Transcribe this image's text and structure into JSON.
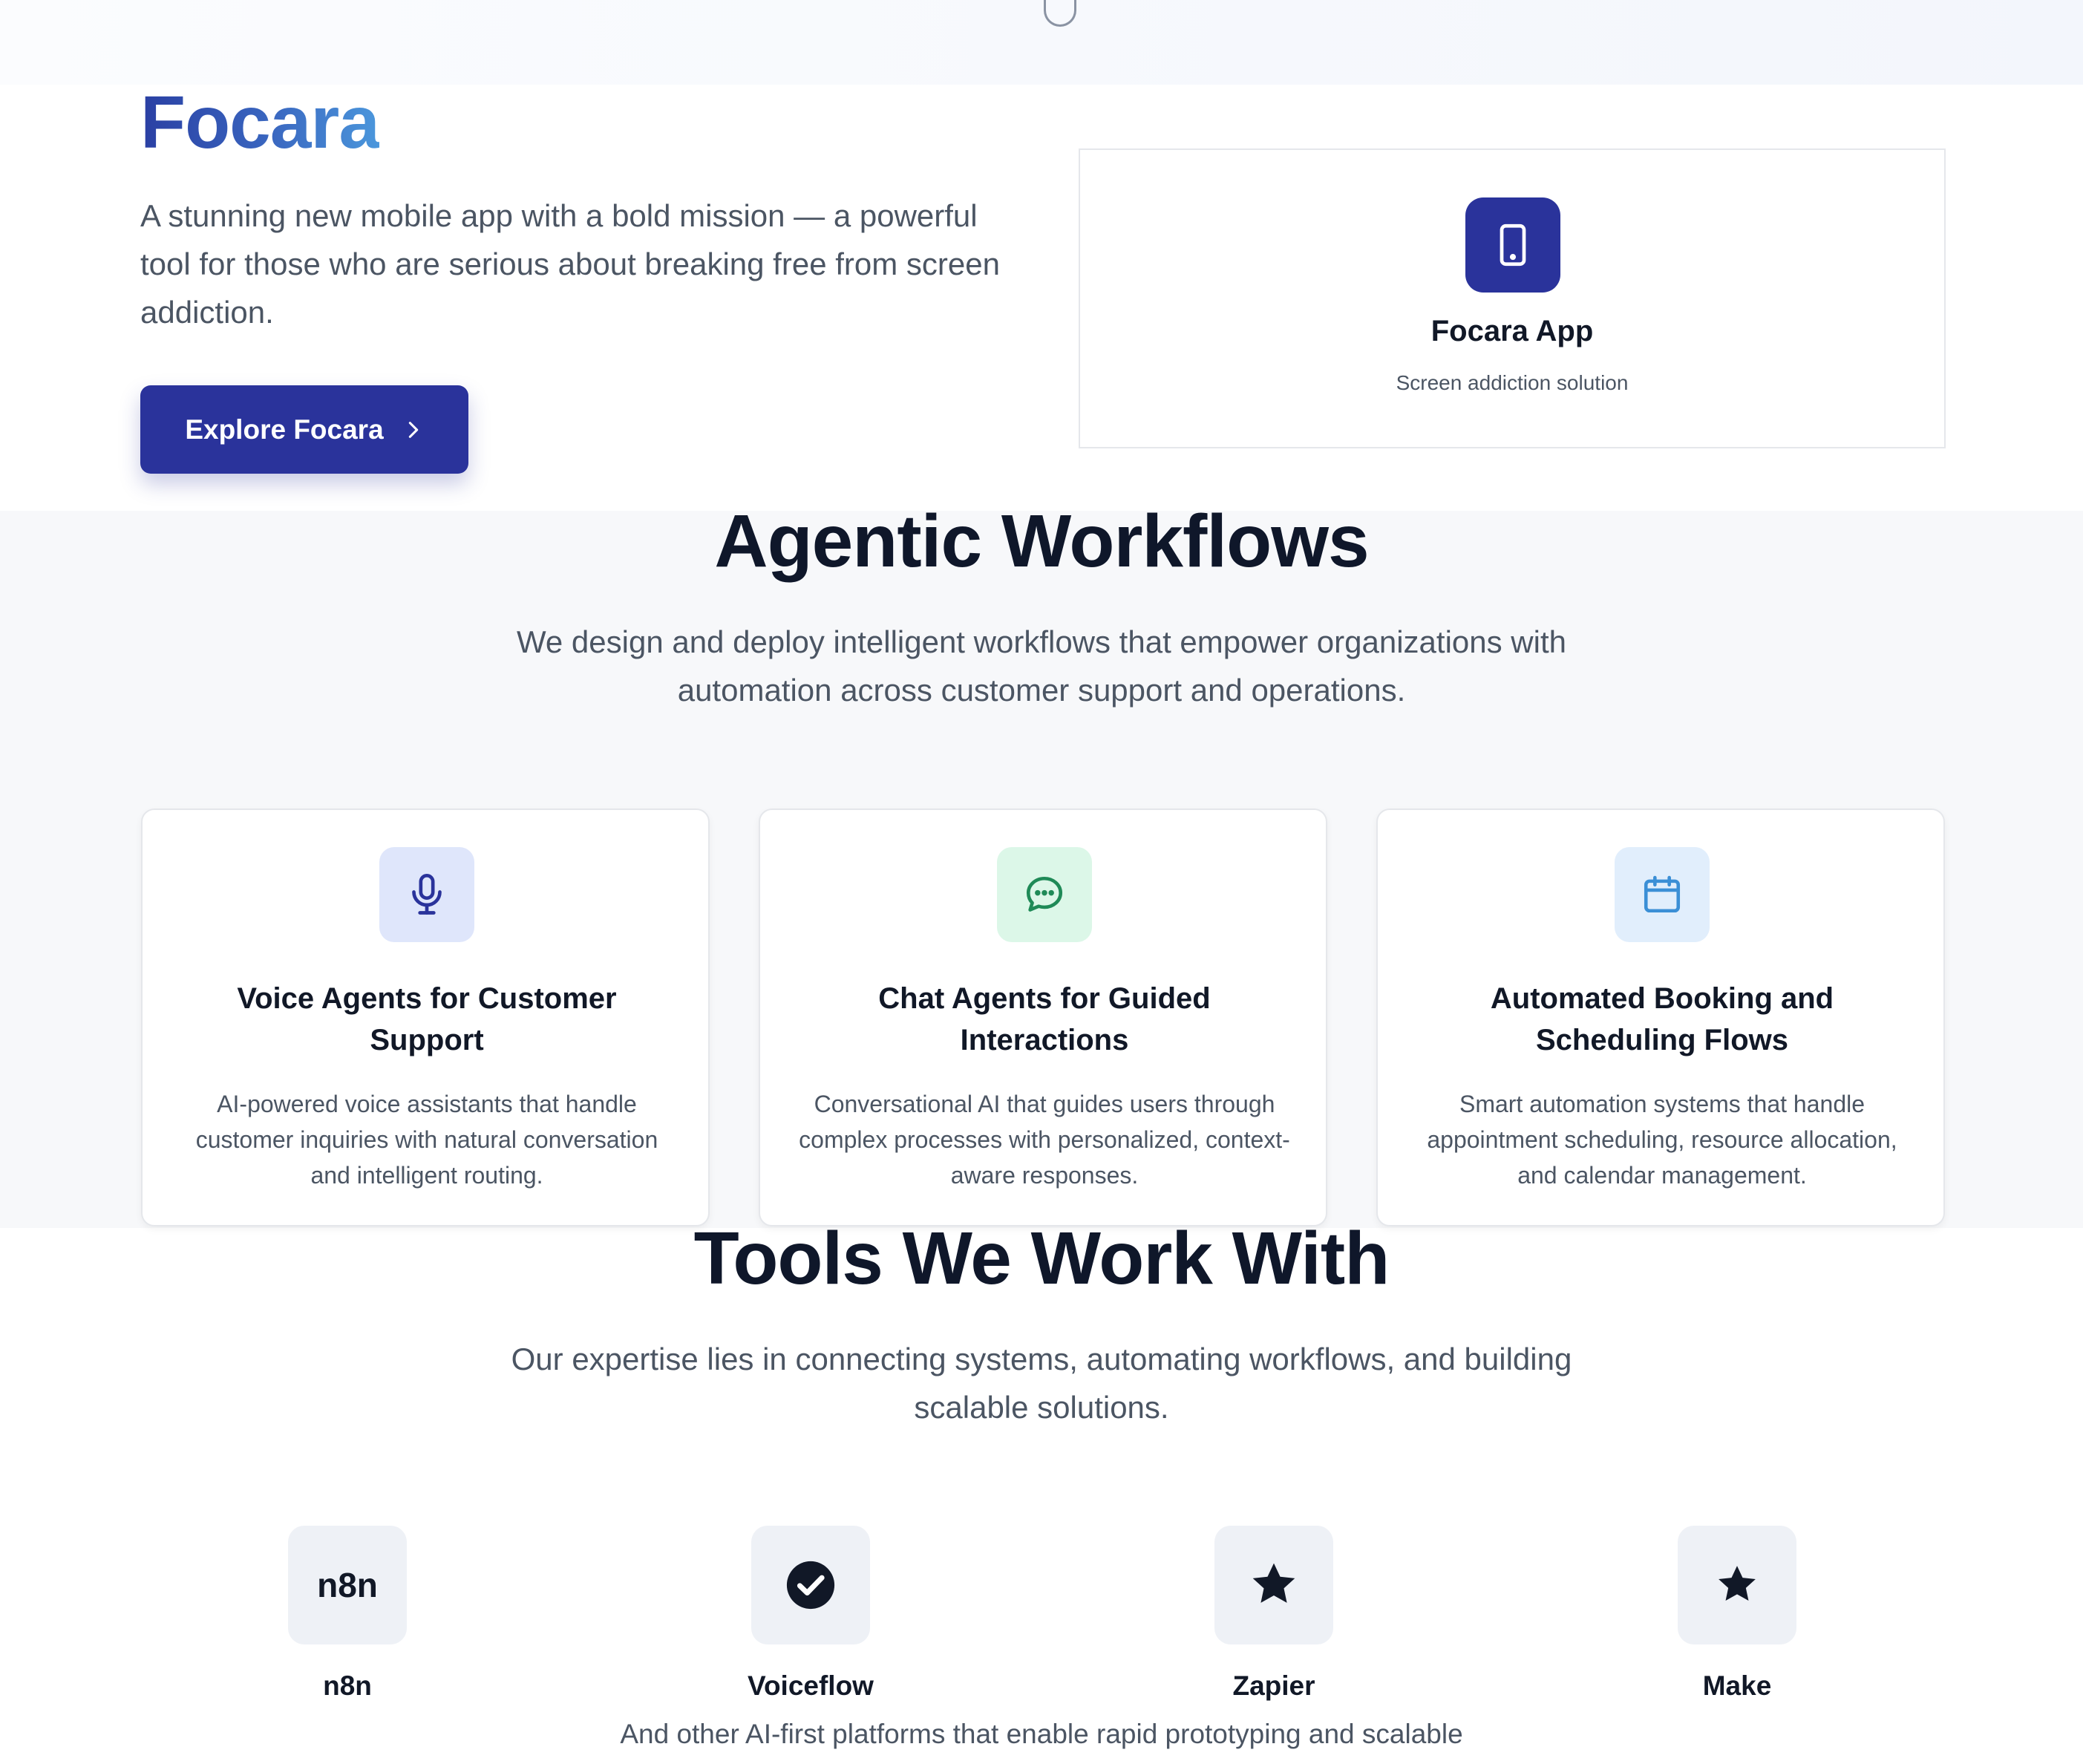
{
  "hero": {
    "title": "Focara",
    "description": "A stunning new mobile app with a bold mission — a powerful tool for those who are serious about breaking free from screen addiction.",
    "button_label": "Explore Focara",
    "app_card": {
      "name": "Focara App",
      "subtitle": "Screen addiction solution",
      "icon": "smartphone-icon"
    }
  },
  "agentic": {
    "title": "Agentic Workflows",
    "description": "We design and deploy intelligent workflows that empower organizations with automation across customer support and operations.",
    "cards": [
      {
        "title": "Voice Agents for Customer Support",
        "text": "AI-powered voice assistants that handle customer inquiries with natural conversation and intelligent routing.",
        "icon": "microphone-icon",
        "icon_bg": "#dfe6fb",
        "icon_color": "#2a339b"
      },
      {
        "title": "Chat Agents for Guided Interactions",
        "text": "Conversational AI that guides users through complex processes with personalized, context-aware responses.",
        "icon": "chat-bubble-icon",
        "icon_bg": "#dcf7e8",
        "icon_color": "#1f8a57"
      },
      {
        "title": "Automated Booking and Scheduling Flows",
        "text": "Smart automation systems that handle appointment scheduling, resource allocation, and calendar management.",
        "icon": "calendar-icon",
        "icon_bg": "#e1eefc",
        "icon_color": "#3b8fd6"
      }
    ]
  },
  "tools": {
    "title": "Tools We Work With",
    "description": "Our expertise lies in connecting systems, automating workflows, and building scalable solutions.",
    "items": [
      {
        "name": "n8n",
        "logo_text": "n8n",
        "icon": "n8n-logo"
      },
      {
        "name": "Voiceflow",
        "icon": "check-circle-icon"
      },
      {
        "name": "Zapier",
        "icon": "star-icon"
      },
      {
        "name": "Make",
        "icon": "star-icon"
      }
    ],
    "footer": "And other AI-first platforms that enable rapid prototyping and scalable"
  },
  "colors": {
    "primary": "#2a339b",
    "title_gradient_start": "#2a3fa3",
    "title_gradient_end": "#4b97dc",
    "section_bg": "#f7f8fa"
  }
}
